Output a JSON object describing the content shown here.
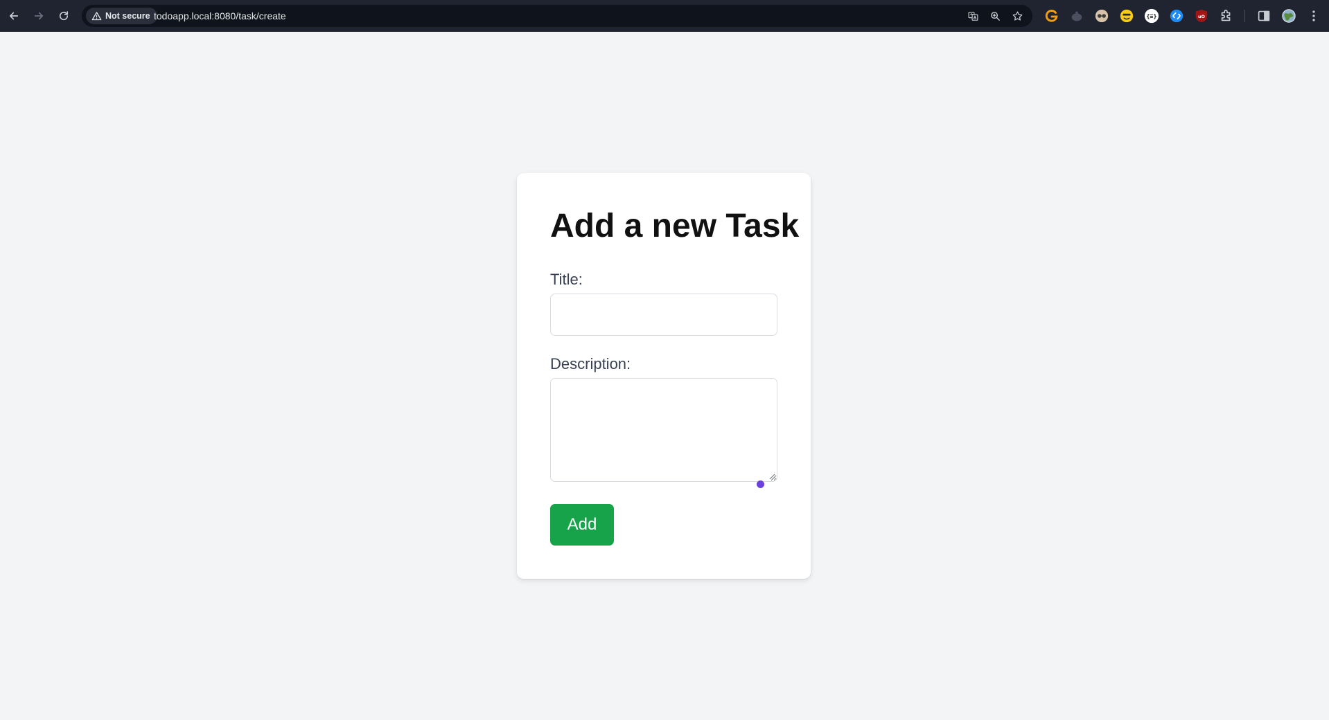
{
  "browser": {
    "security_label": "Not secure",
    "url": "todoapp.local:8080/task/create"
  },
  "page": {
    "title": "Add a new Task",
    "title_field": {
      "label": "Title:",
      "value": ""
    },
    "description_field": {
      "label": "Description:",
      "value": ""
    },
    "submit_label": "Add"
  },
  "icons": {
    "nav": [
      "back-arrow-icon",
      "forward-arrow-icon",
      "reload-icon"
    ],
    "omnibox": [
      "warning-icon",
      "translate-icon",
      "zoom-icon",
      "bookmark-star-icon"
    ],
    "extensions": [
      "extension-g-icon",
      "extension-gray-icon",
      "extension-glasses-icon",
      "extension-smiley-icon",
      "extension-json-icon",
      "extension-shazam-icon",
      "extension-ublock-icon",
      "extensions-puzzle-icon"
    ],
    "toolbar": [
      "side-panel-icon",
      "profile-avatar-icon",
      "more-menu-icon"
    ]
  },
  "colors": {
    "browser_bar": "#1f2430",
    "page_bg": "#f3f4f6",
    "card_bg": "#ffffff",
    "button_bg": "#16a34a",
    "button_text": "#ffffff",
    "cursor_dot": "#6b3fe0"
  }
}
